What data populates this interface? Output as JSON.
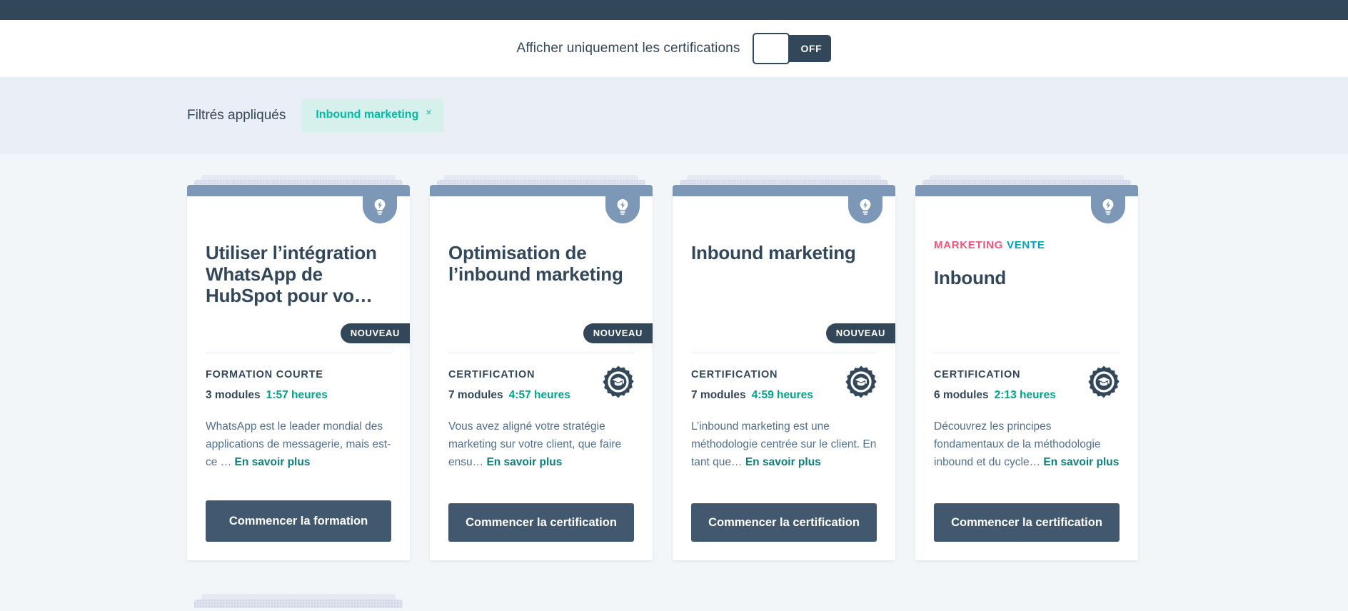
{
  "toggle": {
    "label": "Afficher uniquement les certifications",
    "state_label": "OFF",
    "state": "off"
  },
  "filters": {
    "title": "Filtrés appliqués",
    "chips": [
      {
        "label": "Inbound marketing",
        "remove_icon": "×"
      }
    ]
  },
  "colors": {
    "topbar": "#33475B",
    "filterbar": "#EAEEF7",
    "page_background": "#F2F6F9",
    "chip_background": "#D6F0EC",
    "chip_text": "#00BDA5",
    "accent_hours": "#00A38C",
    "link": "#0F7F7C",
    "cta": "#41586F",
    "tag_marketing": "#F2547D",
    "tag_vente": "#00A4BD",
    "card_tab": "#7C98B6"
  },
  "cards": [
    {
      "tags": [],
      "title": "Utiliser l’intégration WhatsApp de HubSpot pour vo…",
      "badge": "NOUVEAU",
      "kind": "FORMATION COURTE",
      "modules": "3 modules",
      "hours": "1:57 heures",
      "description": "WhatsApp est le leader mondial des applications de messagerie, mais est-ce …",
      "link_label": "En savoir plus",
      "cta_label": "Commencer la formation",
      "has_certification_badge": false,
      "icon": "lightbulb-icon"
    },
    {
      "tags": [],
      "title": "Optimisation de l’inbound marketing",
      "badge": "NOUVEAU",
      "kind": "CERTIFICATION",
      "modules": "7 modules",
      "hours": "4:57 heures",
      "description": "Vous avez aligné votre stratégie marketing sur votre client, que faire ensu…",
      "link_label": "En savoir plus",
      "cta_label": "Commencer la certification",
      "has_certification_badge": true,
      "icon": "lightbulb-icon"
    },
    {
      "tags": [],
      "title": "Inbound marketing",
      "badge": "NOUVEAU",
      "kind": "CERTIFICATION",
      "modules": "7 modules",
      "hours": "4:59 heures",
      "description": "L’inbound marketing est une méthodologie centrée sur le client. En tant que…",
      "link_label": "En savoir plus",
      "cta_label": "Commencer la certification",
      "has_certification_badge": true,
      "icon": "lightbulb-icon"
    },
    {
      "tags": [
        {
          "label": "MARKETING",
          "color": "#F2547D"
        },
        {
          "label": "VENTE",
          "color": "#00A4BD"
        }
      ],
      "title": "Inbound",
      "badge": "",
      "kind": "CERTIFICATION",
      "modules": "6 modules",
      "hours": "2:13 heures",
      "description": "Découvrez les principes fondamentaux de la méthodologie inbound et du cycle…",
      "link_label": "En savoir plus",
      "cta_label": "Commencer la certification",
      "has_certification_badge": true,
      "icon": "lightbulb-icon"
    }
  ]
}
